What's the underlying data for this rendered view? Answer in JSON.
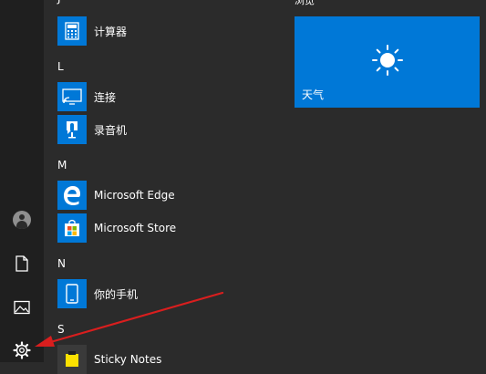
{
  "letters": {
    "j": "J",
    "l": "L",
    "m": "M",
    "n": "N",
    "s": "S"
  },
  "apps": {
    "calculator": "计算器",
    "connect": "连接",
    "recorder": "录音机",
    "edge": "Microsoft Edge",
    "store": "Microsoft Store",
    "phone": "你的手机",
    "sticky": "Sticky Notes"
  },
  "tiles": {
    "group_header": "浏览",
    "weather_label": "天气"
  },
  "icons": {
    "rail": [
      "user-icon",
      "document-icon",
      "pictures-icon",
      "settings-icon"
    ],
    "tile": "sun-icon"
  },
  "colors": {
    "accent": "#0078d7",
    "background": "#2b2b2b",
    "annotation_arrow": "#d91e1e"
  }
}
